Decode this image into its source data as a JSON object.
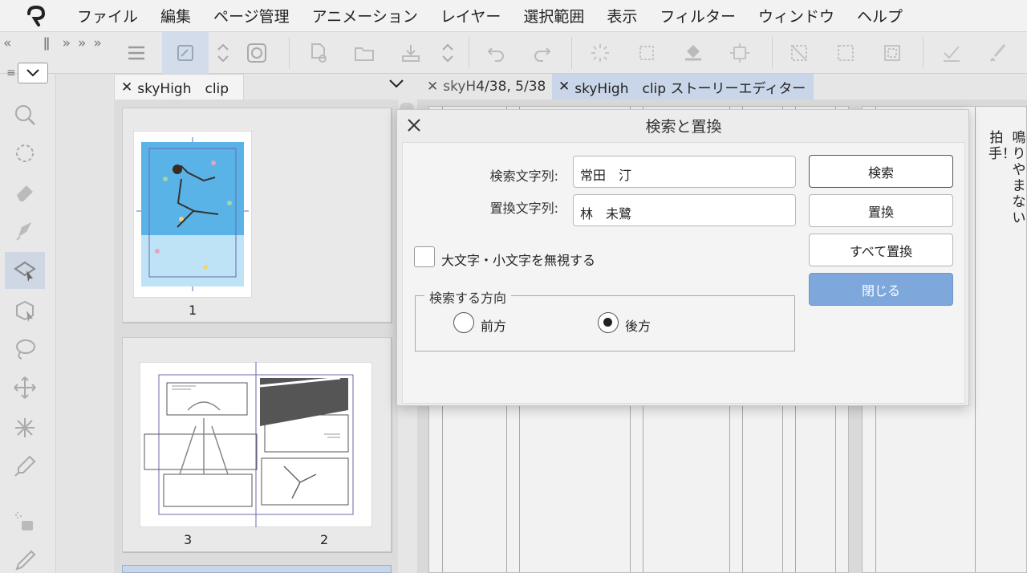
{
  "menu": [
    "ファイル",
    "編集",
    "ページ管理",
    "アニメーション",
    "レイヤー",
    "選択範囲",
    "表示",
    "フィルター",
    "ウィンドウ",
    "ヘルプ"
  ],
  "tabs": {
    "page_manager": "skyHigh　clip",
    "page_view": "skyH",
    "page_view_pages": "4/38, 5/38",
    "story_editor": "skyHigh　clip ストーリーエディター"
  },
  "pages": {
    "first": "1",
    "spread_left": "3",
    "spread_right": "2"
  },
  "vertical_text": {
    "col1": "鳴りやまない",
    "col2": "拍手！"
  },
  "dialog": {
    "title": "検索と置換",
    "search_label": "検索文字列:",
    "search_value": "常田　汀",
    "replace_label": "置換文字列:",
    "replace_value": "林　未鷺",
    "ignore_case_label": "大文字・小文字を無視する",
    "ignore_case_checked": false,
    "direction_label": "検索する方向",
    "direction_forward": "前方",
    "direction_backward": "後方",
    "direction_selected": "後方",
    "buttons": {
      "search": "検索",
      "replace": "置換",
      "replace_all": "すべて置換",
      "close": "閉じる"
    }
  },
  "colors": {
    "accent": "#7ea7dc",
    "active_tab": "#c9d5e8"
  }
}
